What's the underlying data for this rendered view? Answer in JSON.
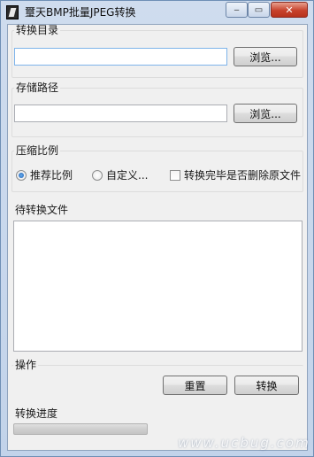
{
  "window": {
    "title": "璽天BMP批量JPEG转换",
    "buttons": {
      "minimize": "‒",
      "maximize": "▭",
      "close": "✕"
    }
  },
  "source_dir": {
    "label": "转换目录",
    "value": "",
    "browse_label": "浏览..."
  },
  "save_path": {
    "label": "存储路径",
    "value": "",
    "browse_label": "浏览..."
  },
  "compression": {
    "label": "压缩比例",
    "recommended_label": "推荐比例",
    "recommended_checked": true,
    "custom_label": "自定义...",
    "custom_checked": false,
    "delete_after_label": "转换完毕是否删除原文件",
    "delete_after_checked": false
  },
  "pending_files": {
    "label": "待转换文件",
    "items": []
  },
  "operations": {
    "label": "操作",
    "reset_label": "重置",
    "convert_label": "转换"
  },
  "progress": {
    "label": "转换进度",
    "fraction": 0
  },
  "watermark": "www.ucbug.com"
}
